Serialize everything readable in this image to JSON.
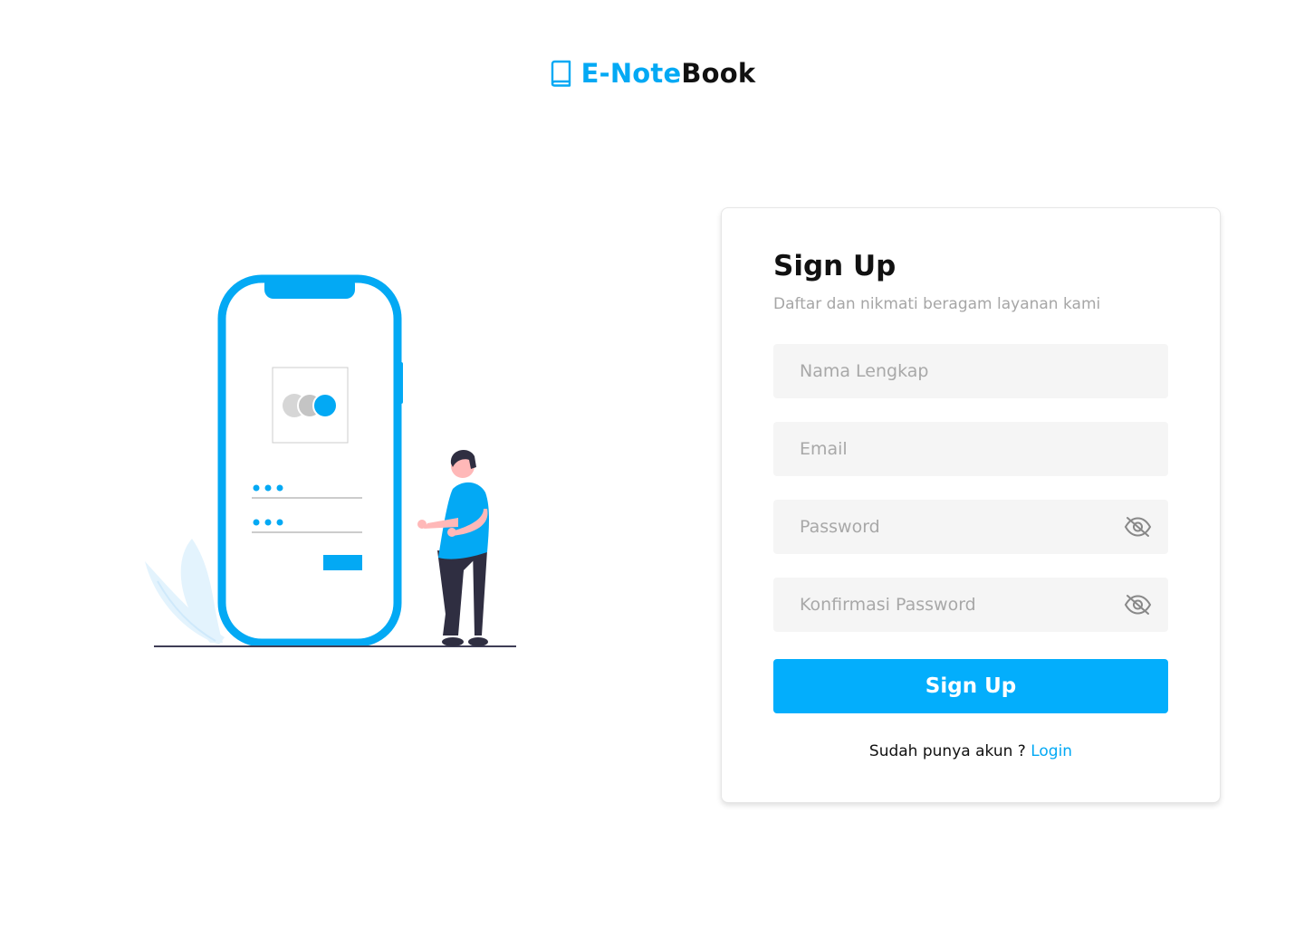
{
  "brand": {
    "accent_text": "E-Note",
    "dark_text": "Book",
    "icon": "book-icon",
    "accent_color": "#03a9f4"
  },
  "illustration": {
    "icon": "phone-login-illustration",
    "accent_color": "#03a9f4"
  },
  "signup": {
    "title": "Sign Up",
    "subtitle": "Daftar dan nikmati beragam layanan kami",
    "fields": {
      "name_placeholder": "Nama Lengkap",
      "email_placeholder": "Email",
      "password_placeholder": "Password",
      "confirm_placeholder": "Konfirmasi Password",
      "password_toggle_icon": "eye-off-icon"
    },
    "submit_label": "Sign Up",
    "button_color": "#03aefc",
    "footer": {
      "prompt": "Sudah punya akun ? ",
      "link_label": "Login"
    }
  }
}
